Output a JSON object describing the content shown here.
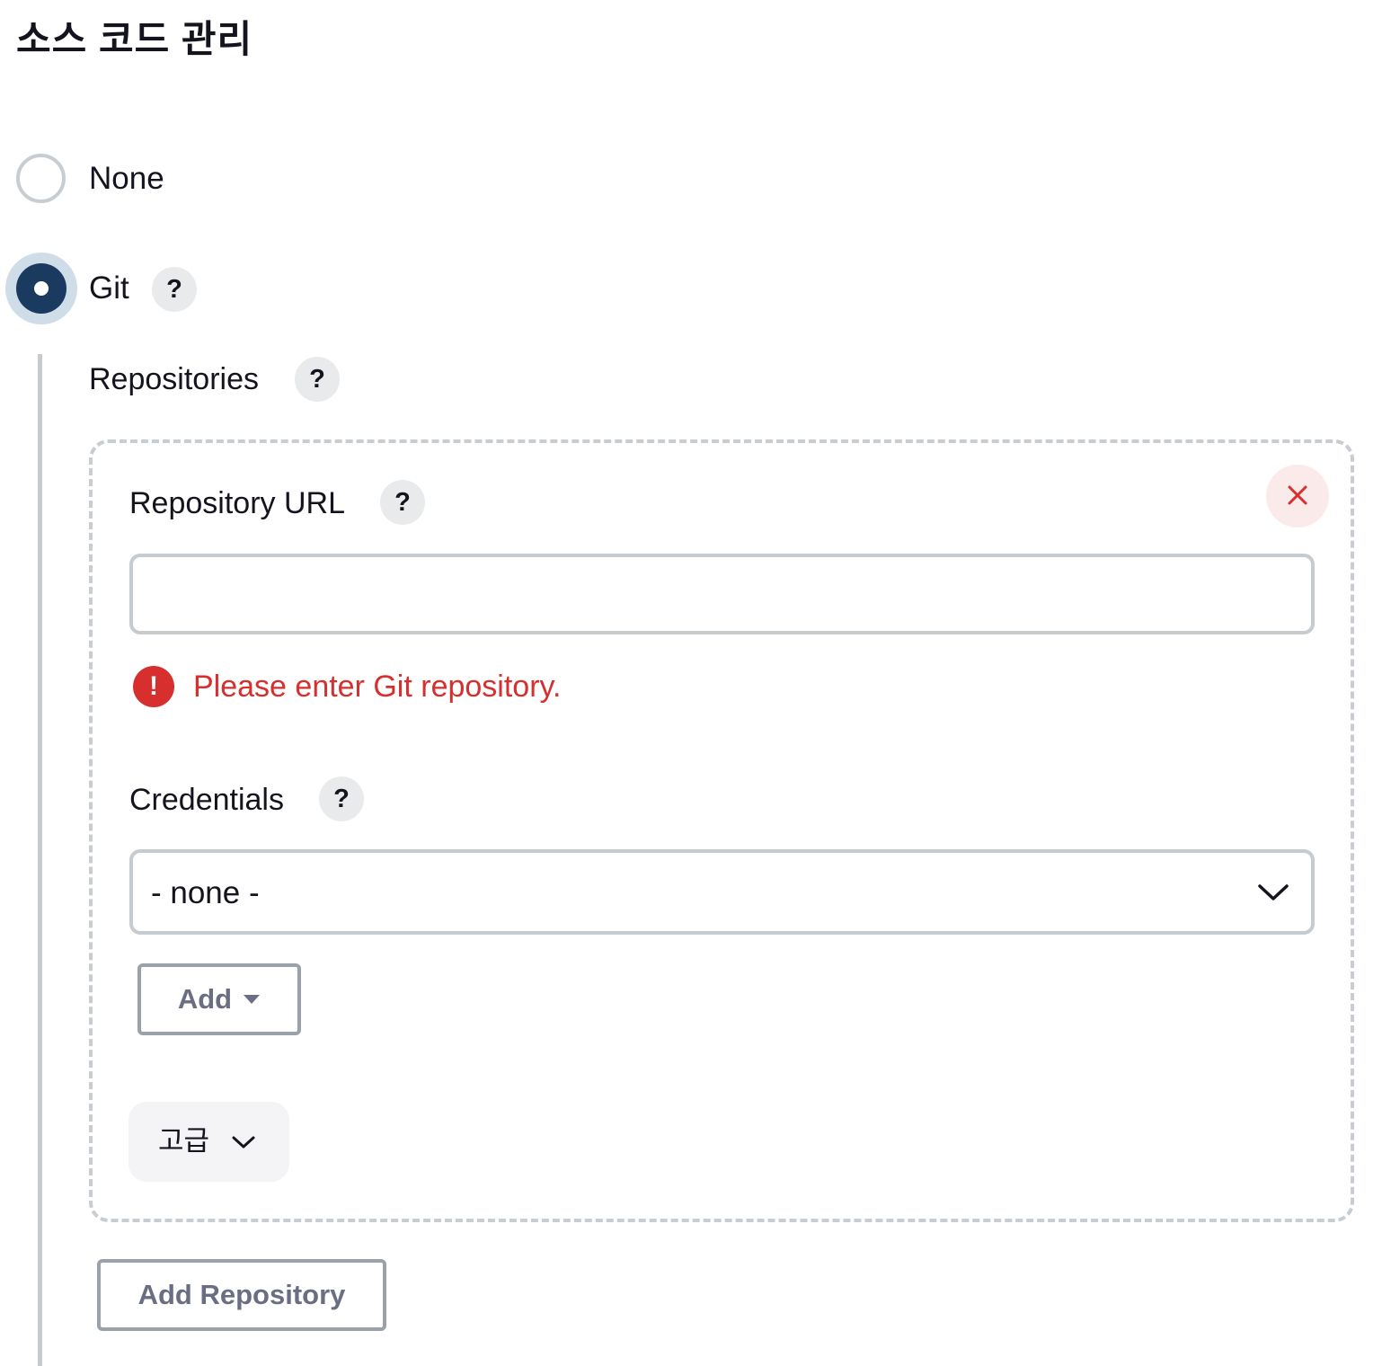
{
  "section": {
    "title": "소스 코드 관리"
  },
  "scm_options": {
    "none_label": "None",
    "git_label": "Git",
    "selected": "Git"
  },
  "help_glyph": "?",
  "repositories": {
    "label": "Repositories",
    "repository_url": {
      "label": "Repository URL",
      "value": "",
      "placeholder": "",
      "error_glyph": "!",
      "error_message": "Please enter Git repository."
    },
    "credentials": {
      "label": "Credentials",
      "selected": "- none -",
      "add_label": "Add"
    },
    "advanced_label": "고급",
    "add_repository_label": "Add Repository"
  },
  "colors": {
    "error": "#d72e2e",
    "radio_selected": "#1a3b5f",
    "radio_halo": "#cfdde9",
    "border": "#c6cbd0",
    "button_text": "#6b6e82"
  },
  "icons": {
    "close": "close-icon",
    "error": "error-icon",
    "dropdown": "chevron-down-icon",
    "add_menu": "caret-down-icon",
    "advanced": "chevron-down-icon"
  }
}
